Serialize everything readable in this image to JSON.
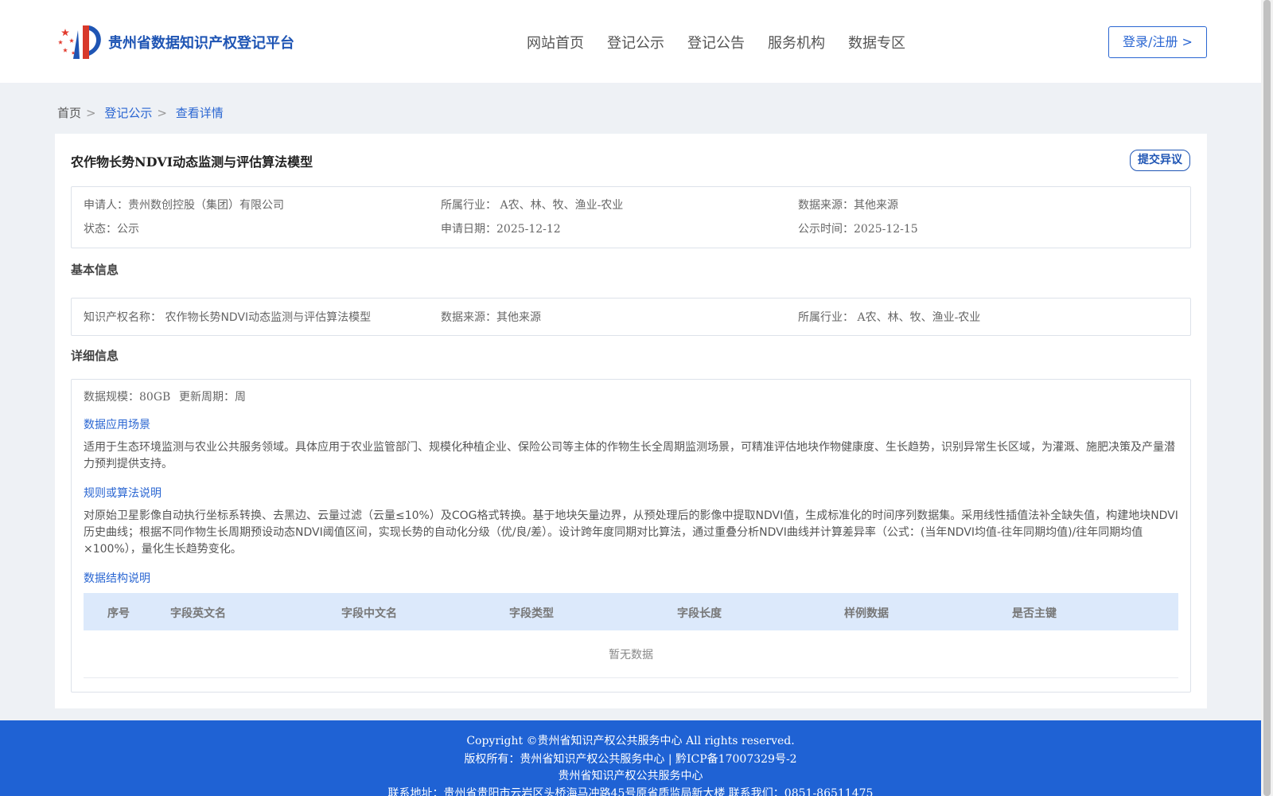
{
  "header": {
    "logo_text": "贵州省数据知识产权登记平台",
    "nav": [
      "网站首页",
      "登记公示",
      "登记公告",
      "服务机构",
      "数据专区"
    ],
    "login_label": "登录/注册 >"
  },
  "breadcrumb": {
    "home": "首页",
    "items": [
      "登记公示",
      "查看详情"
    ],
    "sep": ">"
  },
  "detail": {
    "title": "农作物长势NDVI动态监测与评估算法模型",
    "objection_label": "提交异议",
    "summary": {
      "applicant_label": "申请人：",
      "applicant": "贵州数创控股（集团）有限公司",
      "industry_label": "所属行业：",
      "industry": "A农、林、牧、渔业-农业",
      "source_label": "数据来源：",
      "source": "其他来源",
      "status_label": "状态：",
      "status": "公示",
      "apply_date_label": "申请日期：",
      "apply_date": "2025-12-12",
      "publish_time_label": "公示时间：",
      "publish_time": "2025-12-15"
    },
    "basic": {
      "section_title": "基本信息",
      "ip_name_label": "知识产权名称：",
      "ip_name": "农作物长势NDVI动态监测与评估算法模型",
      "source_label": "数据来源：",
      "source": "其他来源",
      "industry_label": "所属行业：",
      "industry": "A农、林、牧、渔业-农业"
    },
    "details": {
      "section_title": "详细信息",
      "scale_label": "数据规模：",
      "scale": "80GB",
      "cycle_label": "更新周期：",
      "cycle": "周",
      "scenario_title": "数据应用场景",
      "scenario_text": "适用于生态环境监测与农业公共服务领域。具体应用于农业监管部门、规模化种植企业、保险公司等主体的作物生长全周期监测场景，可精准评估地块作物健康度、生长趋势，识别异常生长区域，为灌溉、施肥决策及产量潜力预判提供支持。",
      "algorithm_title": "规则或算法说明",
      "algorithm_text": "对原始卫星影像自动执行坐标系转换、去黑边、云量过滤（云量≤10%）及COG格式转换。基于地块矢量边界，从预处理后的影像中提取NDVI值，生成标准化的时间序列数据集。采用线性插值法补全缺失值，构建地块NDVI历史曲线；根据不同作物生长周期预设动态NDVI阈值区间，实现长势的自动化分级（优/良/差）。设计跨年度同期对比算法，通过重叠分析NDVI曲线并计算差异率（公式：(当年NDVI均值-往年同期均值)/往年同期均值×100%），量化生长趋势变化。",
      "structure_title": "数据结构说明",
      "table_headers": [
        "序号",
        "字段英文名",
        "字段中文名",
        "字段类型",
        "字段长度",
        "样例数据",
        "是否主键"
      ],
      "empty_text": "暂无数据"
    }
  },
  "footer": {
    "copyright": "Copyright ©贵州省知识产权公共服务中心 All rights reserved.",
    "owner": "版权所有：贵州省知识产权公共服务中心 | 黔ICP备17007329号-2",
    "org": "贵州省知识产权公共服务中心",
    "address": "联系地址：贵州省贵阳市云岩区头桥海马冲路45号原省质监局新大楼 联系我们：0851-86511475"
  }
}
